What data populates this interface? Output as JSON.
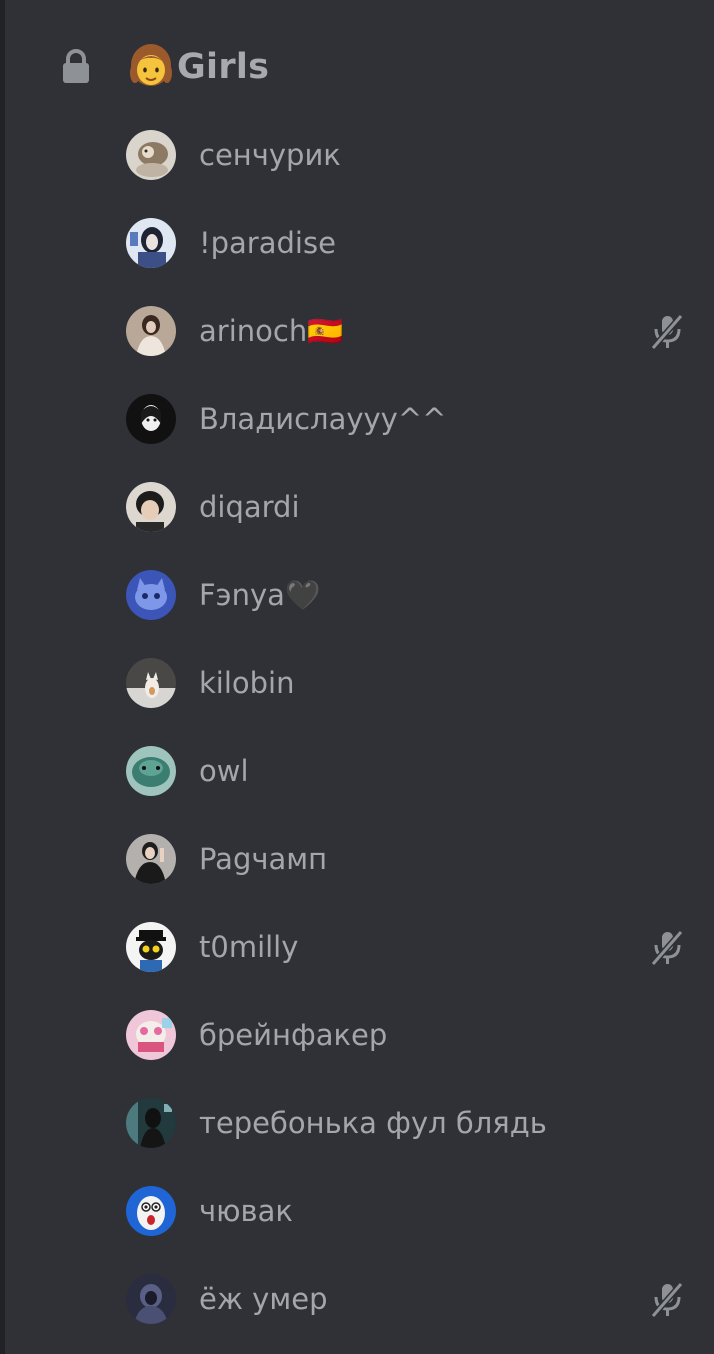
{
  "channel": {
    "name": "Girls",
    "emoji": "girl-emoji",
    "locked": true
  },
  "members": [
    {
      "name": "сенчурик",
      "avatar_color": "#b9a894",
      "muted": false
    },
    {
      "name": "!paradise",
      "avatar_color": "#9fb2c8",
      "muted": false
    },
    {
      "name": "arinoch🇪🇸",
      "avatar_color": "#7d6356",
      "muted": true
    },
    {
      "name": "Владислауyy^^",
      "avatar_color": "#1b1b1b",
      "muted": false
    },
    {
      "name": "diqardi",
      "avatar_color": "#c9c4bc",
      "muted": false
    },
    {
      "name": "Fэnya🖤",
      "avatar_color": "#4d6cd1",
      "muted": false
    },
    {
      "name": "kilobin",
      "avatar_color": "#5c5a58",
      "muted": false
    },
    {
      "name": "owl",
      "avatar_color": "#3f8a7b",
      "muted": false
    },
    {
      "name": "Pagчамп",
      "avatar_color": "#878787",
      "muted": false
    },
    {
      "name": "t0milly",
      "avatar_color": "#f2f2f2",
      "muted": true
    },
    {
      "name": "брейнфакер",
      "avatar_color": "#e7a3c2",
      "muted": false
    },
    {
      "name": "теребонька фул блядь",
      "avatar_color": "#2f4d52",
      "muted": false
    },
    {
      "name": "чювак",
      "avatar_color": "#2b6fd6",
      "muted": false
    },
    {
      "name": "ёж умер",
      "avatar_color": "#3a3f5a",
      "muted": true
    }
  ],
  "colors": {
    "background": "#2f3136",
    "text": "#a3a6ab",
    "icon": "#8e9297"
  }
}
